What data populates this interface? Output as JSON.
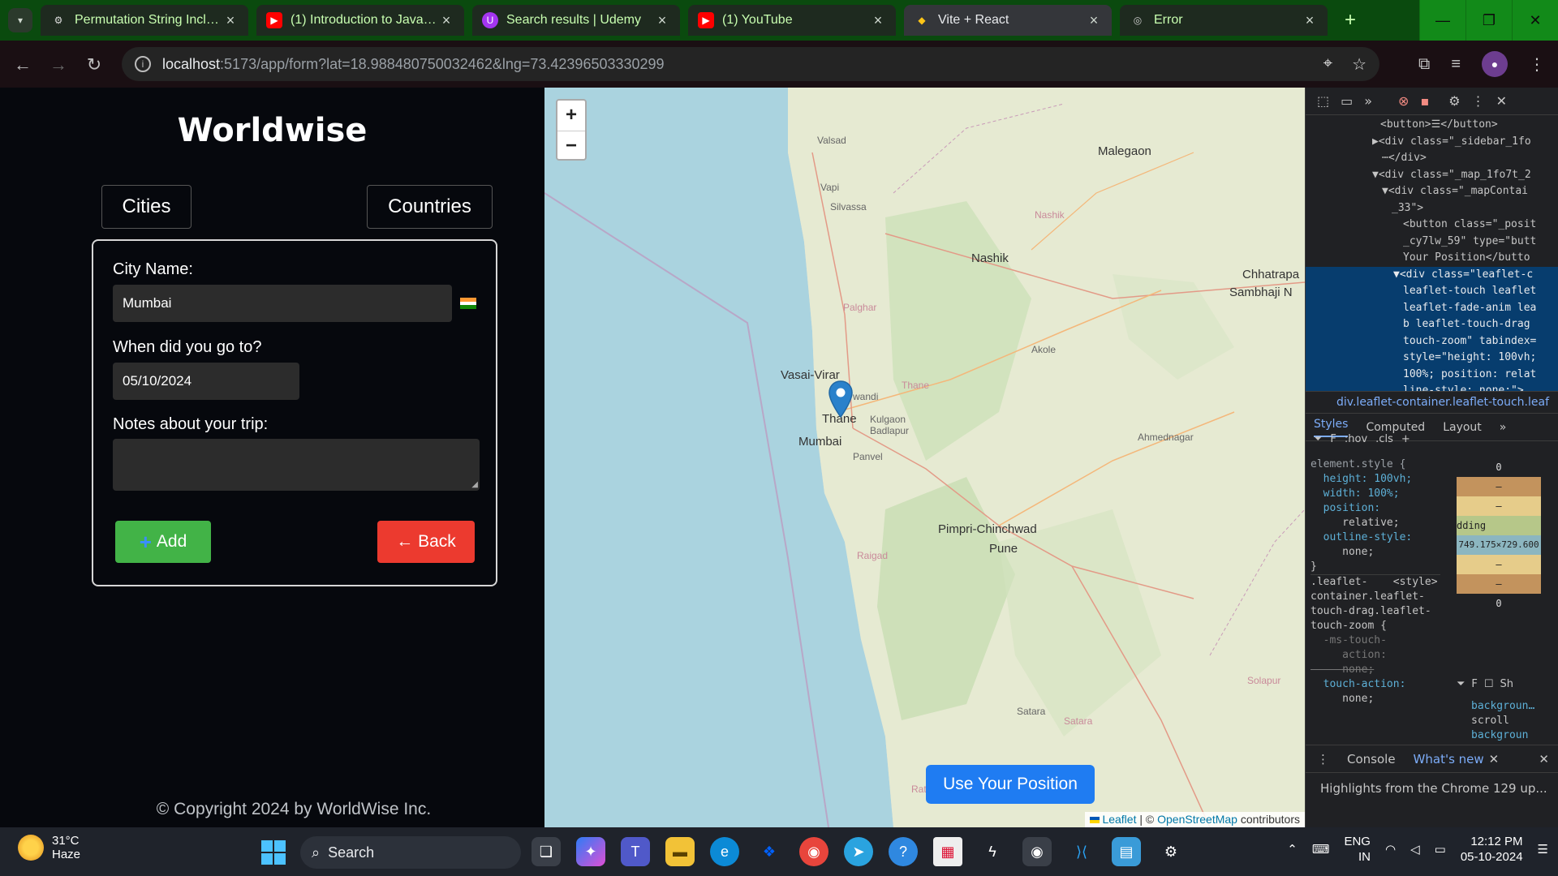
{
  "browser": {
    "tabs": [
      {
        "title": "Permutation String Inclusio",
        "icon": "openai-icon",
        "active": false
      },
      {
        "title": "(1) Introduction to Java + I",
        "icon": "youtube-icon",
        "active": false
      },
      {
        "title": "Search results | Udemy",
        "icon": "udemy-icon",
        "active": false
      },
      {
        "title": "(1) YouTube",
        "icon": "youtube-icon",
        "active": false
      },
      {
        "title": "Vite + React",
        "icon": "vite-icon",
        "active": true
      },
      {
        "title": "Error",
        "icon": "globe-icon",
        "active": false
      }
    ],
    "url_host": "localhost",
    "url_path": ":5173/app/form?lat=18.988480750032462&lng=73.42396503330299"
  },
  "sidebar": {
    "logo": "Worldwise",
    "tab_cities": "Cities",
    "tab_countries": "Countries",
    "form": {
      "city_label": "City Name:",
      "city_value": "Mumbai",
      "date_label": "When did you go to?",
      "date_value": "05/10/2024",
      "notes_label": "Notes about your trip:",
      "notes_value": "",
      "add_label": "Add",
      "back_label": "← Back"
    },
    "copyright": "© Copyright 2024 by WorldWise Inc."
  },
  "map": {
    "zoom_in": "+",
    "zoom_out": "−",
    "use_position": "Use Your Position",
    "attribution_leaflet": "Leaflet",
    "attribution_sep": " | © ",
    "attribution_osm": "OpenStreetMap",
    "attribution_tail": " contributors",
    "labels": {
      "valsad": "Valsad",
      "malegaon": "Malegaon",
      "vapi": "Vapi",
      "silvassa": "Silvassa",
      "nashik_small": "Nashik",
      "nashik": "Nashik",
      "chhatrapati": "Chhatrapa",
      "sambhaji": "Sambhaji N",
      "palghar": "Palghar",
      "akole": "Akole",
      "vasai": "Vasai-Virar",
      "bhiwandi": "wandi",
      "thane_small": "Thane",
      "thane": "Thane",
      "kulgaon": "Kulgaon",
      "badlapur": "Badlapur",
      "mumbai": "Mumbai",
      "panvel": "Panvel",
      "ahmednagar": "Ahmednagar",
      "pimpri": "Pimpri-Chinchwad",
      "pune": "Pune",
      "raigad": "Raigad",
      "solapur": "Solapur",
      "satara": "Satara",
      "satara_small": "Satara",
      "rat": "Rat"
    }
  },
  "devtools": {
    "tree": [
      "<button>☰</button>",
      "▶<div class=\"_sidebar_1fo",
      "⋯</div>",
      "▼<div class=\"_map_1fo7t_2",
      "▼<div class=\"_mapContai",
      "_33\">",
      "<button class=\"_posit",
      "_cy7lw_59\" type=\"butt",
      "Your Position</butto",
      "▼<div class=\"leaflet-c",
      "leaflet-touch leaflet",
      "leaflet-fade-anim lea",
      "b leaflet-touch-drag",
      "touch-zoom\" tabindex=",
      "style=\"height: 100vh;",
      "100%; position: relat",
      "line-style: none;\">"
    ],
    "breadcrumb": "div.leaflet-container.leaflet-touch.leaf",
    "tabs": [
      "Styles",
      "Computed",
      "Layout"
    ],
    "filter": "F",
    "hov": ":hov",
    "cls": ".cls",
    "styles": [
      "element.style {",
      "  height: 100vh;",
      "  width: 100%;",
      "  position:",
      "     relative;",
      "  outline-style:",
      "     none;",
      "}",
      ".leaflet-    <style>",
      "container.leaflet-",
      "touch-drag.leaflet-",
      "touch-zoom {",
      "  -ms-touch-",
      "     action:",
      "     none;",
      "  touch-action:",
      "     none;"
    ],
    "box_values": [
      "0",
      "–",
      "–",
      "dding",
      "749.175×729.600",
      "–",
      "–",
      "0"
    ],
    "computed_filter": "F",
    "show_all": "Sh",
    "computed": [
      "backgroun…",
      "scroll",
      "backgroun"
    ],
    "console_tab": "Console",
    "whatsnew_tab": "What's new",
    "console_text": "Highlights from the Chrome 129 up..."
  },
  "taskbar": {
    "temperature": "31°C",
    "weather": "Haze",
    "search": "Search",
    "lang1": "ENG",
    "lang2": "IN",
    "time": "12:12 PM",
    "date": "05-10-2024"
  }
}
